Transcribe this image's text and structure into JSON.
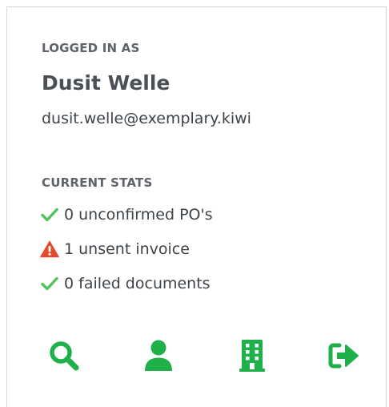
{
  "account": {
    "section_label": "LOGGED IN AS",
    "name": "Dusit Welle",
    "email": "dusit.welle@exemplary.kiwi"
  },
  "stats": {
    "section_label": "CURRENT STATS",
    "items": [
      {
        "status": "ok",
        "icon": "checkmark-icon",
        "text": "0 unconfirmed PO's"
      },
      {
        "status": "warning",
        "icon": "warning-triangle-icon",
        "text": "1 unsent invoice"
      },
      {
        "status": "ok",
        "icon": "checkmark-icon",
        "text": "0 failed documents"
      }
    ]
  },
  "toolbar": [
    {
      "icon": "search-icon"
    },
    {
      "icon": "user-icon"
    },
    {
      "icon": "building-icon"
    },
    {
      "icon": "sign-out-icon"
    }
  ],
  "colors": {
    "accent": "#1fb04a",
    "check": "#52c25a",
    "warning": "#e34a2e"
  }
}
